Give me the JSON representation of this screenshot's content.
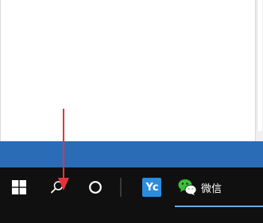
{
  "taskbar": {
    "start_icon": "windows-logo-icon",
    "search_icon": "search-icon",
    "cortana_icon": "cortana-circle-icon",
    "apps": [
      {
        "icon": "yc-app-icon",
        "tile_text": "Yc"
      },
      {
        "icon": "wechat-icon",
        "label": "微信"
      }
    ]
  },
  "colors": {
    "desktop": "#2a6db6",
    "taskbar": "#101010",
    "annotation_arrow": "#e8323a",
    "yc_tile": "#2c8ddd",
    "wechat_green": "#3bbf3a"
  }
}
